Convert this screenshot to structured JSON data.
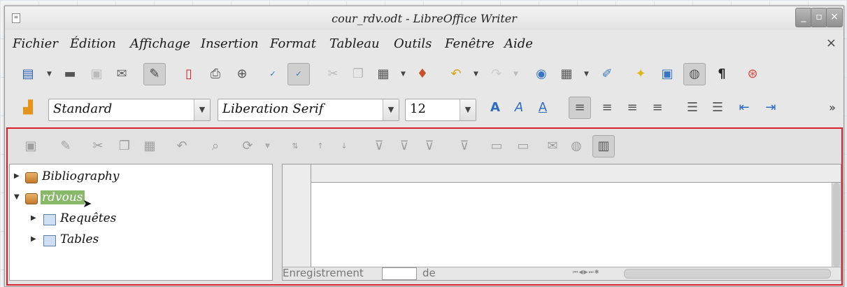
{
  "window": {
    "title": "cour_rdv.odt - LibreOffice Writer",
    "controls": {
      "minimize": "_",
      "maximize": "▫",
      "close": "×"
    }
  },
  "menubar": {
    "items": [
      "Fichier",
      "Édition",
      "Affichage",
      "Insertion",
      "Format",
      "Tableau",
      "Outils",
      "Fenêtre",
      "Aide"
    ],
    "close_document": "×"
  },
  "formatting": {
    "paragraph_style": "Standard",
    "font_name": "Liberation Serif",
    "font_size": "12",
    "overflow": "»"
  },
  "standard_toolbar": {
    "pilcrow": "¶"
  },
  "datasource": {
    "tree": [
      {
        "label": "Bibliography",
        "expanded": false
      },
      {
        "label": "rdvous",
        "expanded": true,
        "selected": true,
        "children": [
          {
            "label": "Requêtes"
          },
          {
            "label": "Tables"
          }
        ]
      }
    ],
    "navigation": {
      "record_label": "Enregistrement",
      "of_label": "de"
    }
  },
  "colors": {
    "highlight_border": "#d9202a",
    "selection": "#88b86a"
  }
}
